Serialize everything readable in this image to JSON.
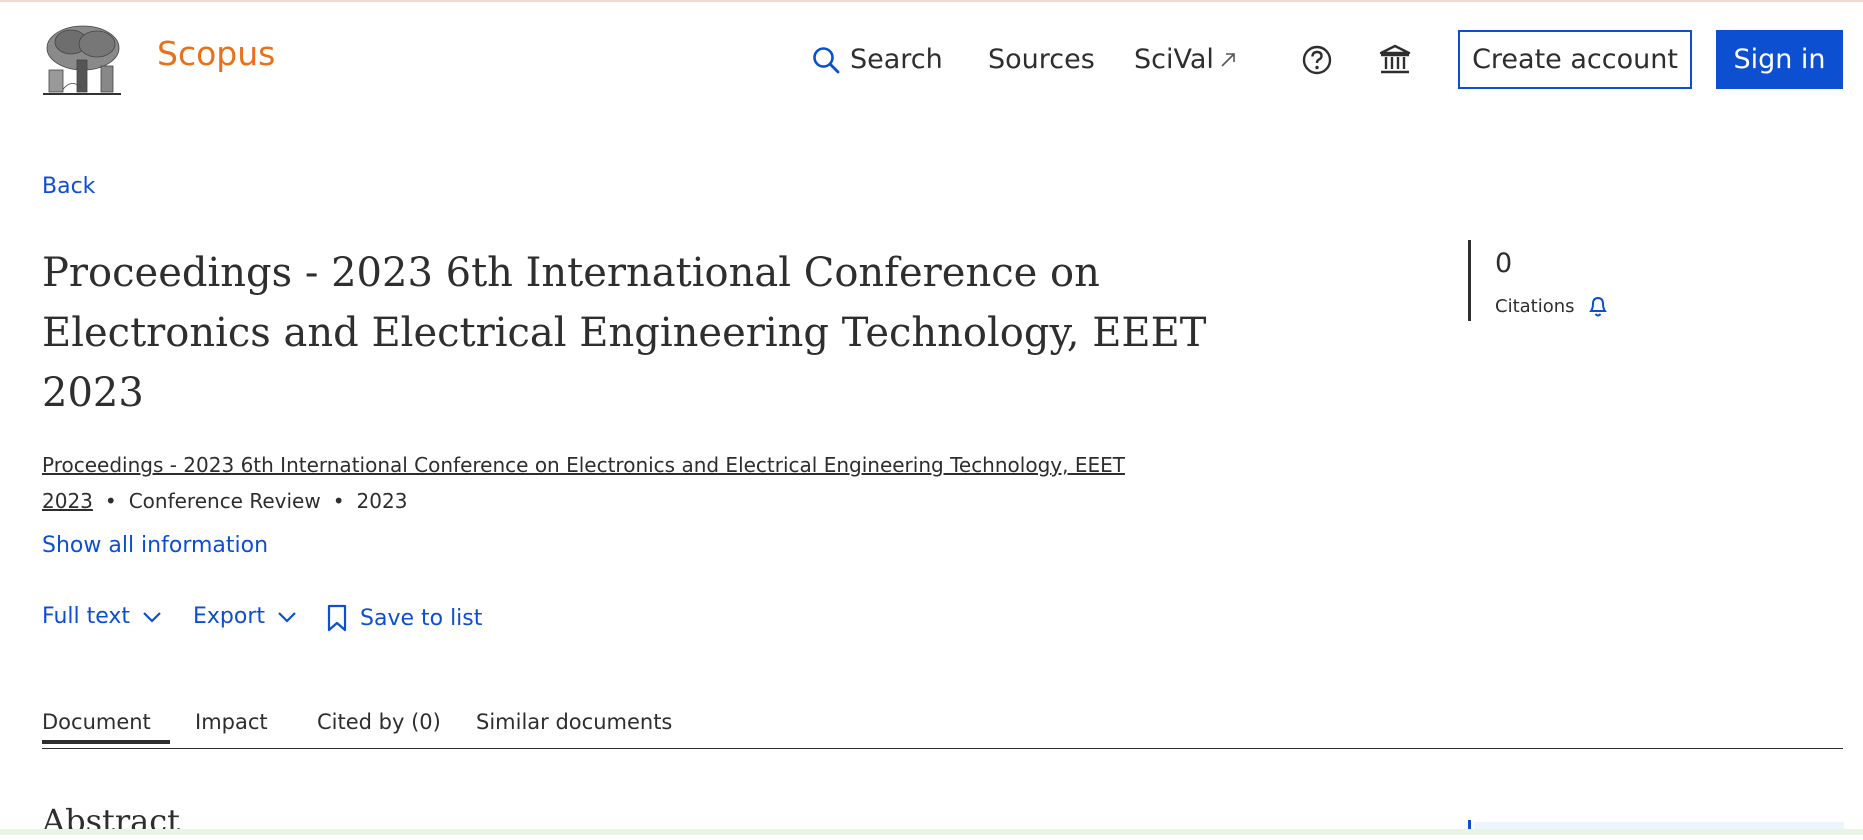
{
  "header": {
    "brand": "Scopus",
    "nav": {
      "search": "Search",
      "sources": "Sources",
      "scival": "SciVal"
    },
    "create_account": "Create account",
    "sign_in": "Sign in"
  },
  "document": {
    "back": "Back",
    "title": "Proceedings - 2023 6th International Conference on Electronics and Electrical Engineering Technology, EEET 2023",
    "source_link": "Proceedings - 2023 6th International Conference on Electronics and Electrical Engineering Technology, EEET 2023",
    "doc_type": "Conference Review",
    "year": "2023",
    "separator": "•",
    "show_all": "Show all information"
  },
  "actions": {
    "full_text": "Full text",
    "export": "Export",
    "save_to_list": "Save to list"
  },
  "citations": {
    "count": "0",
    "label": "Citations"
  },
  "tabs": [
    {
      "label": "Document",
      "active": true
    },
    {
      "label": "Impact",
      "active": false
    },
    {
      "label": "Cited by (0)",
      "active": false
    },
    {
      "label": "Similar documents",
      "active": false
    }
  ],
  "section": {
    "abstract": "Abstract"
  },
  "colors": {
    "brand": "#e9711c",
    "link": "#0c4fd0",
    "text": "#2e2e2e"
  },
  "icons": {
    "search": "search-icon",
    "external": "external-link-icon",
    "help": "help-circle-icon",
    "institution": "institution-icon",
    "chevron": "chevron-down-icon",
    "bookmark": "bookmark-icon",
    "bell": "bell-icon"
  }
}
